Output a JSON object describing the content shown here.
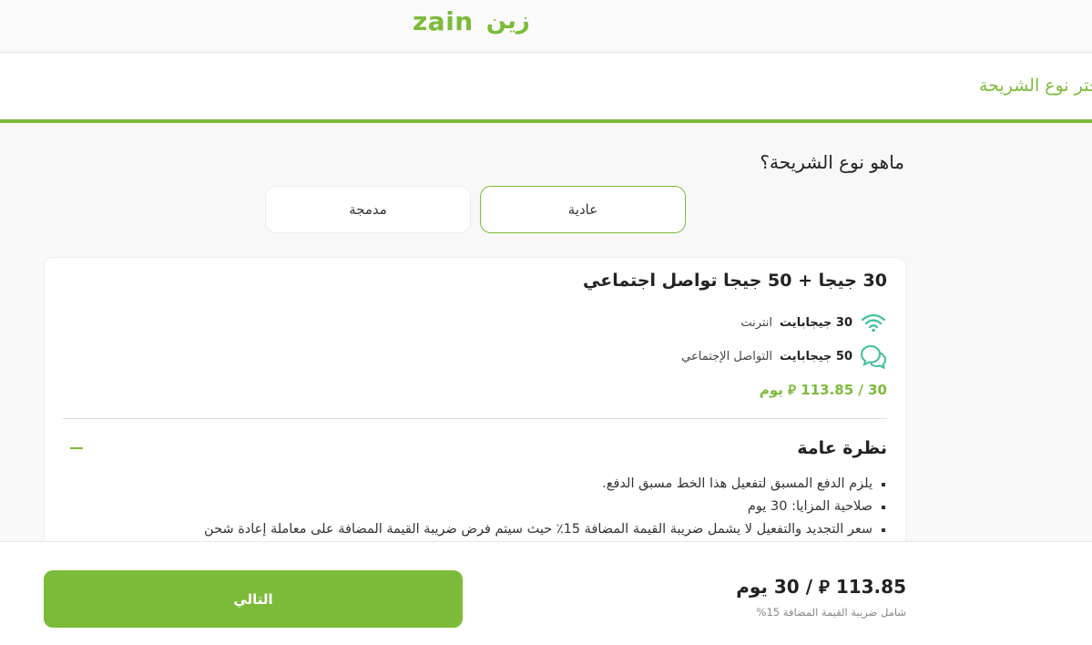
{
  "header": {
    "logo_latin": "zain",
    "logo_arabic": "زين"
  },
  "step": {
    "title": "اختر نوع الشريحة"
  },
  "sim_type": {
    "question": "ماهو نوع الشريحة؟",
    "options": [
      {
        "label": "عادية",
        "selected": true
      },
      {
        "label": "مدمجة",
        "selected": false
      }
    ]
  },
  "plan": {
    "title": "30 جيجا + 50 جيجا تواصل اجتماعي",
    "features": [
      {
        "icon": "wifi-icon",
        "amount": "30 جيجابايت",
        "label": "انترنت"
      },
      {
        "icon": "chat-bubbles-icon",
        "amount": "50 جيجابايت",
        "label": "التواصل الإجتماعي"
      }
    ],
    "price_line": "30 / 113.85 ⃁ يوم",
    "overview_title": "نظرة عامة",
    "overview_items": [
      "يلزم الدفع المسبق لتفعيل هذا الخط مسبق الدفع.",
      "صلاحية المزايا: 30 يوم",
      "سعر التجديد والتفعيل لا يشمل ضريبة القيمة المضافة 15٪ حيث سيتم فرض ضريبة القيمة المضافة على معاملة إعادة شحن"
    ]
  },
  "footer": {
    "next_label": "التالي",
    "total_price": "113.85 ⃁ / 30 يوم",
    "vat_note": "شامل ضريبة القيمة المضافة 15%"
  },
  "colors": {
    "brand_green": "#7cbb3a",
    "wifi_teal": "#3fbf9a"
  }
}
